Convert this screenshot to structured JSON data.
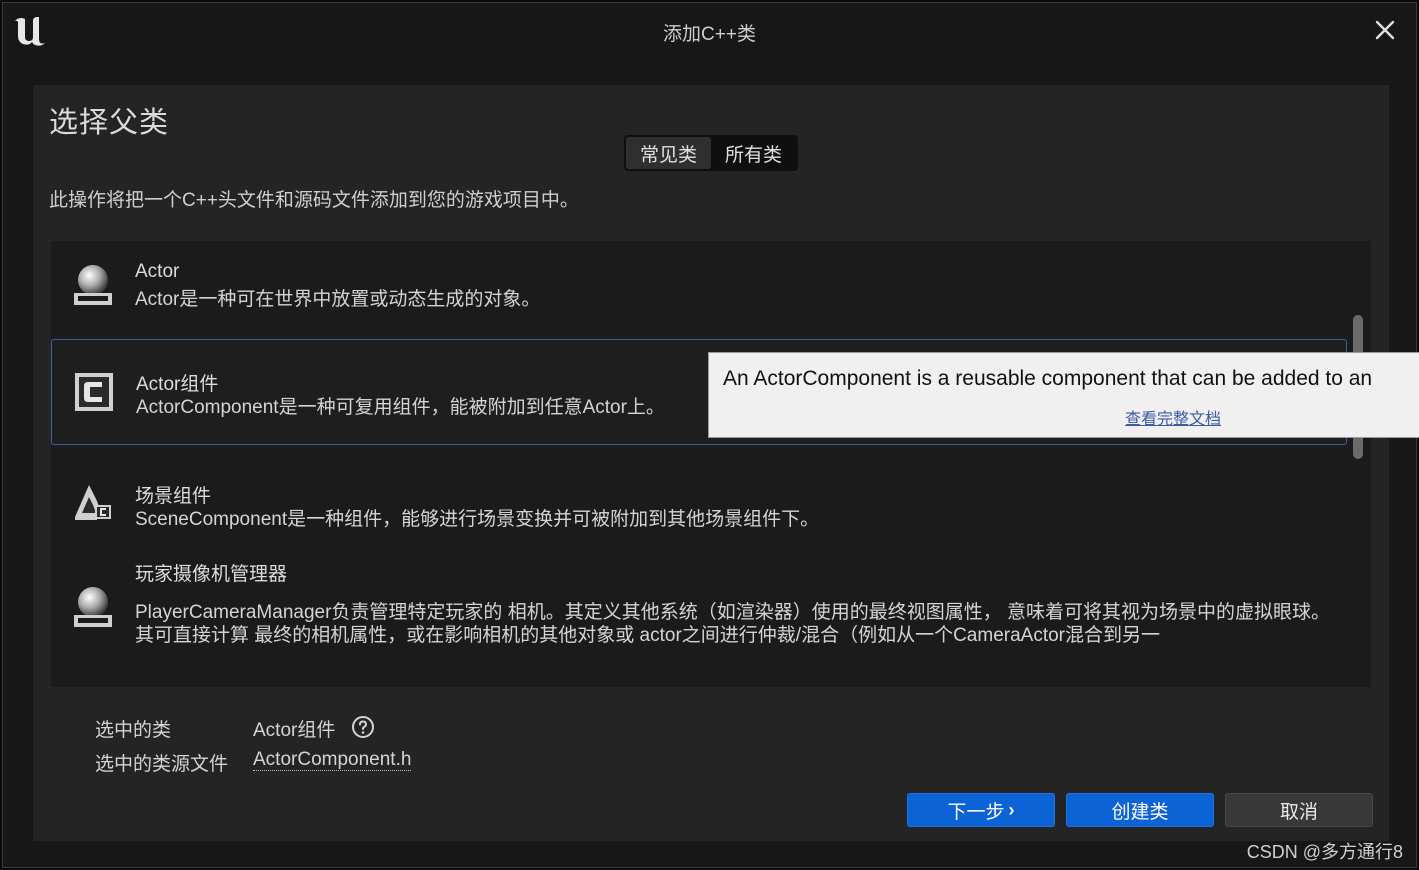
{
  "window": {
    "title": "添加C++类"
  },
  "panel": {
    "heading": "选择父类",
    "tabs": [
      {
        "label": "常见类",
        "active": true
      },
      {
        "label": "所有类",
        "active": false
      }
    ],
    "description": "此操作将把一个C++头文件和源码文件添加到您的游戏项目中。"
  },
  "classes": [
    {
      "title": "Actor",
      "description": "Actor是一种可在世界中放置或动态生成的对象。",
      "icon": "sphere-actor-icon"
    },
    {
      "title": "Actor组件",
      "description": "ActorComponent是一种可复用组件，能被附加到任意Actor上。",
      "icon": "component-c-icon",
      "selected": true
    },
    {
      "title": "场景组件",
      "description": "SceneComponent是一种组件，能够进行场景变换并可被附加到其他场景组件下。",
      "icon": "scene-component-icon"
    },
    {
      "title": "玩家摄像机管理器",
      "description": "PlayerCameraManager负责管理特定玩家的 相机。其定义其他系统（如渲染器）使用的最终视图属性， 意味着可将其视为场景中的虚拟眼球。其可直接计算 最终的相机属性，或在影响相机的其他对象或 actor之间进行仲裁/混合（例如从一个CameraActor混合到另一",
      "icon": "sphere-actor-icon"
    }
  ],
  "tooltip": {
    "text": "An ActorComponent is a reusable component that can be added to an",
    "link": "查看完整文档"
  },
  "selection": {
    "class_label": "选中的类",
    "class_value": "Actor组件",
    "file_label": "选中的类源文件",
    "file_value": "ActorComponent.h"
  },
  "buttons": {
    "next": "下一步",
    "create": "创建类",
    "cancel": "取消"
  },
  "watermark": "CSDN @多方通行8",
  "colors": {
    "accent": "#0b63d6",
    "background": "#242424",
    "list_background": "#1b1b1b",
    "selection_border": "#3d5e9a"
  }
}
